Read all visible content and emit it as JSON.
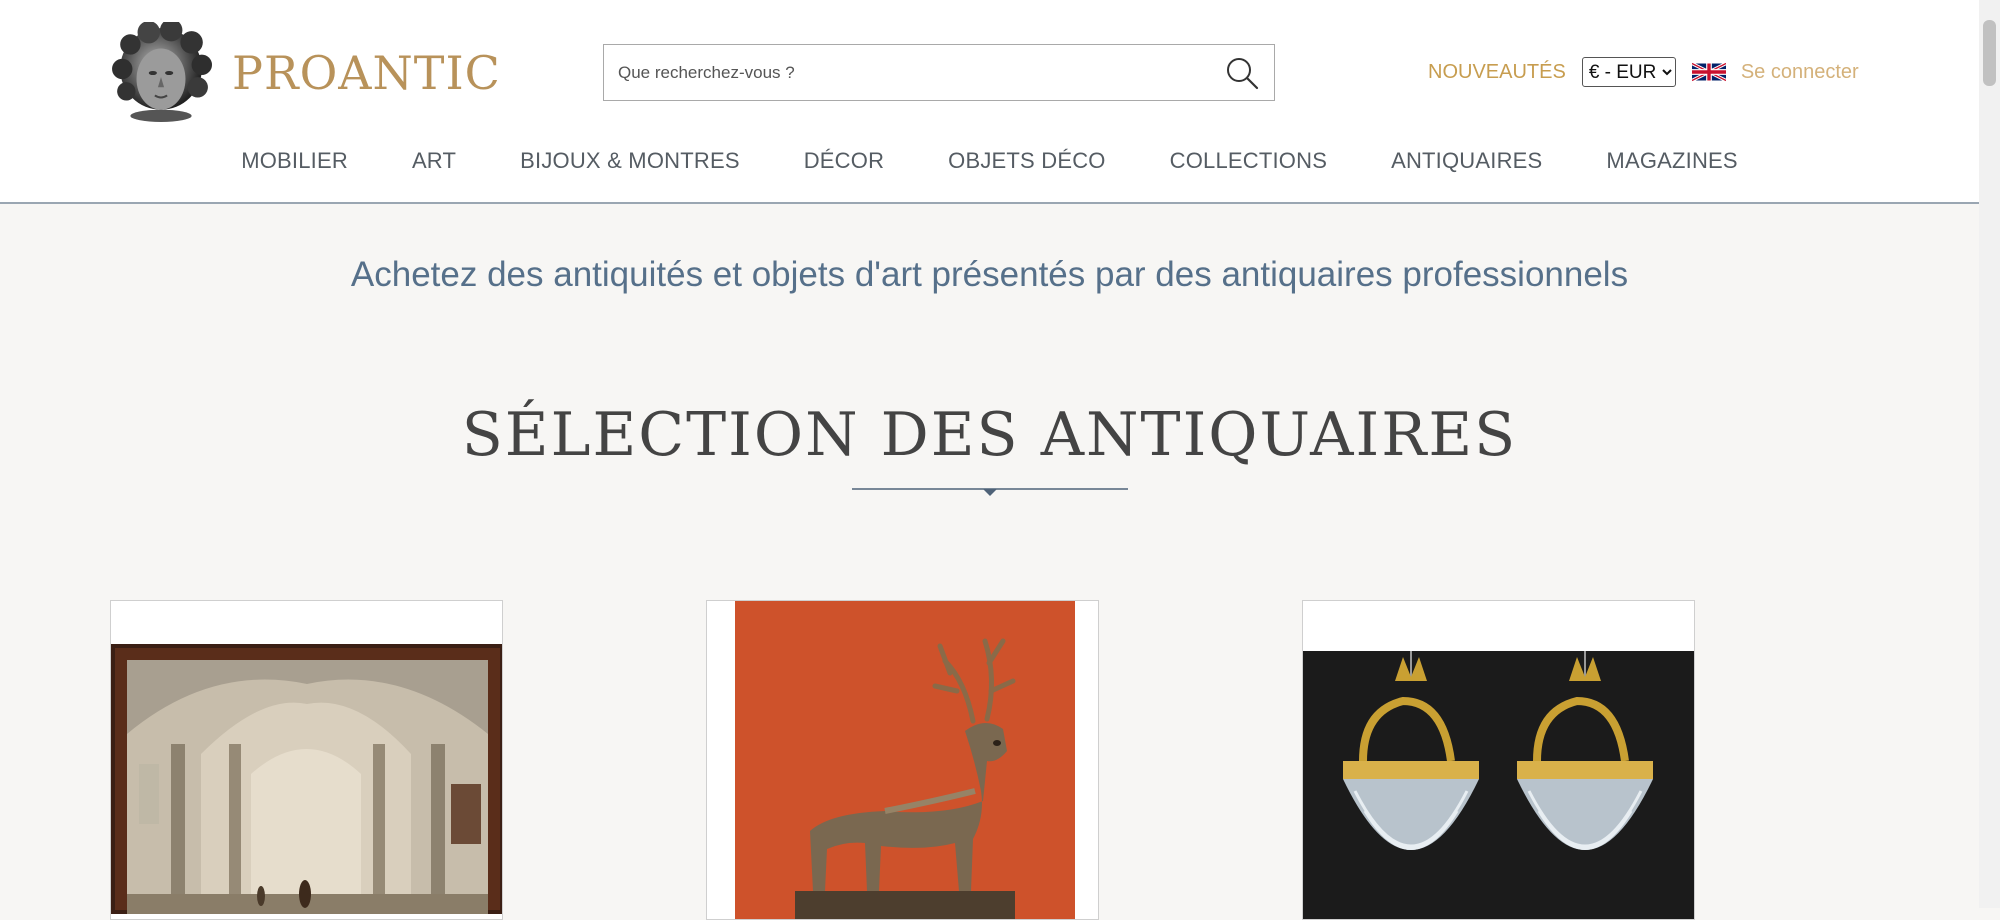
{
  "brand": {
    "name": "PROANTIC"
  },
  "search": {
    "placeholder": "Que recherchez-vous ?"
  },
  "top_links": {
    "new_label": "NOUVEAUTÉS",
    "currency_selected": "€ - EUR",
    "login_label": "Se connecter"
  },
  "nav": {
    "items": [
      {
        "label": "MOBILIER"
      },
      {
        "label": "ART"
      },
      {
        "label": "BIJOUX & MONTRES"
      },
      {
        "label": "DÉCOR"
      },
      {
        "label": "OBJETS DÉCO"
      },
      {
        "label": "COLLECTIONS"
      },
      {
        "label": "ANTIQUAIRES"
      },
      {
        "label": "MAGAZINES"
      }
    ]
  },
  "main": {
    "tagline": "Achetez des antiquités et objets d'art présentés par des antiquaires professionnels",
    "section_title": "SÉLECTION DES ANTIQUAIRES"
  },
  "colors": {
    "brand_gold": "#b8925a",
    "link_gold": "#c79d4f",
    "tagline_blue": "#56708a",
    "divider": "#4f6278"
  },
  "icons": {
    "search": "search-icon",
    "flag": "uk-flag-icon",
    "logo": "cherub-head-logo"
  }
}
